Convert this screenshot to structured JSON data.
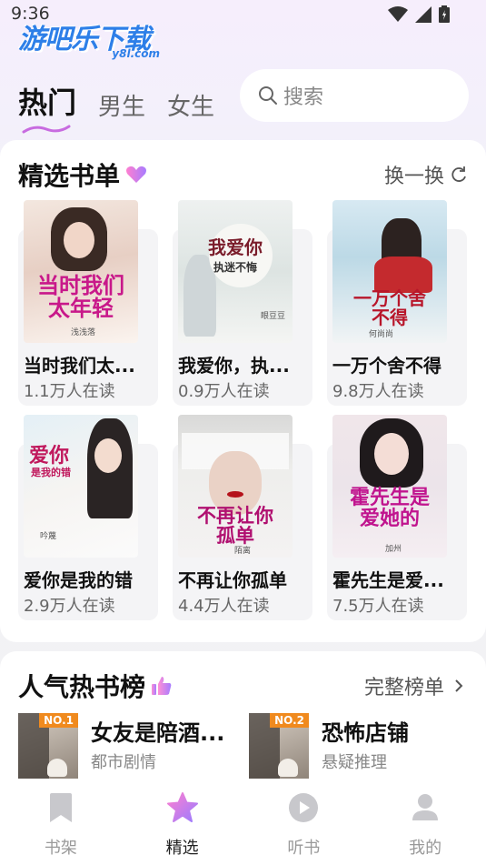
{
  "status_bar": {
    "time": "9:36"
  },
  "logo": {
    "text": "游吧乐下载",
    "sub": "y8l.com"
  },
  "tabs": [
    {
      "label": "热门",
      "active": true
    },
    {
      "label": "男生",
      "active": false
    },
    {
      "label": "女生",
      "active": false
    }
  ],
  "search": {
    "placeholder": "搜索"
  },
  "featured": {
    "title": "精选书单",
    "refresh_label": "换一换",
    "books": [
      {
        "title": "当时我们太...",
        "reads": "1.1万人在读",
        "cover_text": "当时我们太年轻",
        "author": "浅浅落"
      },
      {
        "title": "我爱你，执...",
        "reads": "0.9万人在读",
        "cover_text": "我爱你",
        "cover_sub": "执迷不悔",
        "author": "眼豆豆"
      },
      {
        "title": "一万个舍不得",
        "reads": "9.8万人在读",
        "cover_text": "一万个舍不得",
        "author": "何尚尚"
      },
      {
        "title": "爱你是我的错",
        "reads": "2.9万人在读",
        "cover_text": "爱你",
        "cover_sub": "是我的错",
        "author": "吟蔑"
      },
      {
        "title": "不再让你孤单",
        "reads": "4.4万人在读",
        "cover_text": "不再让你孤单",
        "author": "陌离"
      },
      {
        "title": "霍先生是爱...",
        "reads": "7.5万人在读",
        "cover_text": "霍先生是爱她的",
        "author": "加州"
      }
    ]
  },
  "ranking": {
    "title": "人气热书榜",
    "more_label": "完整榜单",
    "items": [
      {
        "badge": "NO.1",
        "title": "女友是陪酒...",
        "genre": "都市剧情"
      },
      {
        "badge": "NO.2",
        "title": "恐怖店铺",
        "genre": "悬疑推理"
      }
    ]
  },
  "bottom_nav": [
    {
      "label": "书架",
      "icon": "bookmark-icon",
      "active": false
    },
    {
      "label": "精选",
      "icon": "star-icon",
      "active": true
    },
    {
      "label": "听书",
      "icon": "play-icon",
      "active": false
    },
    {
      "label": "我的",
      "icon": "user-icon",
      "active": false
    }
  ],
  "colors": {
    "accent": "#f07ad6",
    "star_gradient": [
      "#ff7fd0",
      "#9a7cff"
    ],
    "badge": "#f08a1e"
  }
}
